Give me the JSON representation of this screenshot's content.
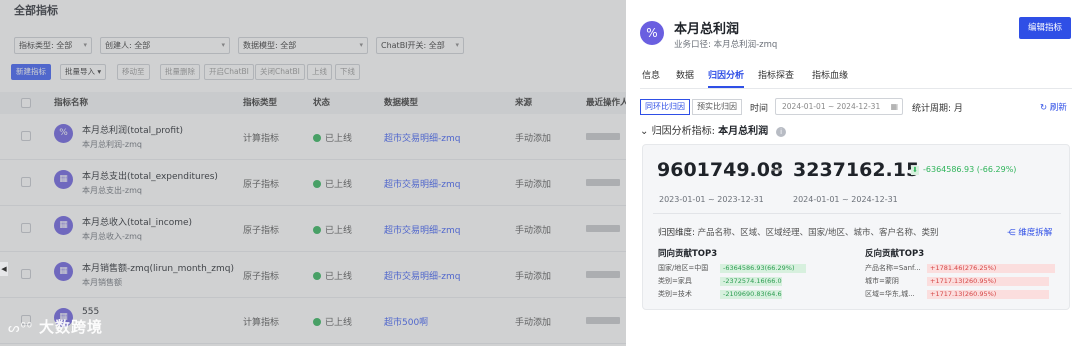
{
  "left": {
    "title": "全部指标",
    "filters": [
      "指标类型: 全部",
      "创建人: 全部",
      "数据模型: 全部",
      "ChatBI开关: 全部"
    ],
    "buttons": {
      "new": "新建指标",
      "import": "批量导入",
      "move": "移动至",
      "batch_delete": "批量删除",
      "enable_chatbi": "开启ChatBI",
      "disable_chatbi": "关闭ChatBI",
      "online": "上线",
      "offline": "下线"
    },
    "columns": [
      "指标名称",
      "指标类型",
      "状态",
      "数据模型",
      "来源",
      "最近操作人"
    ],
    "rows": [
      {
        "name": "本月总利润(total_profit)",
        "desc": "本月总利润-zmq",
        "icon": "percent-icon",
        "type": "计算指标",
        "status": "已上线",
        "model": "超市交易明细-zmq",
        "source": "手动添加"
      },
      {
        "name": "本月总支出(total_expenditures)",
        "desc": "本月总支出-zmq",
        "icon": "metric-icon",
        "type": "原子指标",
        "status": "已上线",
        "model": "超市交易明细-zmq",
        "source": "手动添加"
      },
      {
        "name": "本月总收入(total_income)",
        "desc": "本月总收入-zmq",
        "icon": "metric-icon",
        "type": "原子指标",
        "status": "已上线",
        "model": "超市交易明细-zmq",
        "source": "手动添加"
      },
      {
        "name": "本月销售额-zmq(lirun_month_zmq)",
        "desc": "本月销售额",
        "icon": "metric-icon",
        "type": "原子指标",
        "status": "已上线",
        "model": "超市交易明细-zmq",
        "source": "手动添加"
      },
      {
        "name": "555",
        "desc": "",
        "icon": "metric-icon",
        "type": "计算指标",
        "status": "已上线",
        "model": "超市500啊",
        "source": "手动添加"
      }
    ],
    "collapse_glyph": "◀",
    "watermark": "大数跨境"
  },
  "drawer": {
    "title": "本月总利润",
    "subtitle": "业务口径: 本月总利润-zmq",
    "edit_button": "编辑指标",
    "tabs": [
      "信息",
      "数据",
      "归因分析",
      "指标探查",
      "指标血缘"
    ],
    "active_tab": "归因分析",
    "compare": {
      "yoy": "同环比归因",
      "forecast": "预实比归因"
    },
    "time_label": "时间",
    "date_range": "2024-01-01 ~ 2024-12-31",
    "period_label": "统计周期: 月",
    "refresh": "刷新",
    "attribution_label": "归因分析指标:",
    "attribution_metric": "本月总利润",
    "base_value": "9601749.08",
    "current_value": "3237162.15",
    "change": "-6364586.93 (-66.29%)",
    "base_period": "2023-01-01 ~ 2023-12-31",
    "current_period": "2024-01-01 ~ 2024-12-31",
    "dims_label": "归因维度:",
    "dims_value": "产品名称、区域、区域经理、国家/地区、城市、客户名称、类别",
    "dim_breakdown": "维度拆解",
    "positive_title": "同向贡献TOP3",
    "negative_title": "反向贡献TOP3",
    "positive": [
      {
        "key": "国家/地区=中国",
        "value": "-6364586.93(66.29%)",
        "share": 0.66
      },
      {
        "key": "类别=家具",
        "value": "-2372574.16(66.07%)",
        "share": 0.24
      },
      {
        "key": "类别=技术",
        "value": "-2109690.83(64.60%)",
        "share": 0.22
      }
    ],
    "negative": [
      {
        "key": "产品名称=Sanf...",
        "value": "+1781.46(276.25%)",
        "share": 1.0
      },
      {
        "key": "城市=蒙阴",
        "value": "+1717.13(260.95%)",
        "share": 0.95
      },
      {
        "key": "区域=华东,城...",
        "value": "+1717.13(260.95%)",
        "share": 0.95
      }
    ],
    "colors": {
      "accent": "#2f4fe6",
      "down": "#2fb45a",
      "up": "#d64545",
      "icon_bg": "#6a5fe0"
    }
  }
}
